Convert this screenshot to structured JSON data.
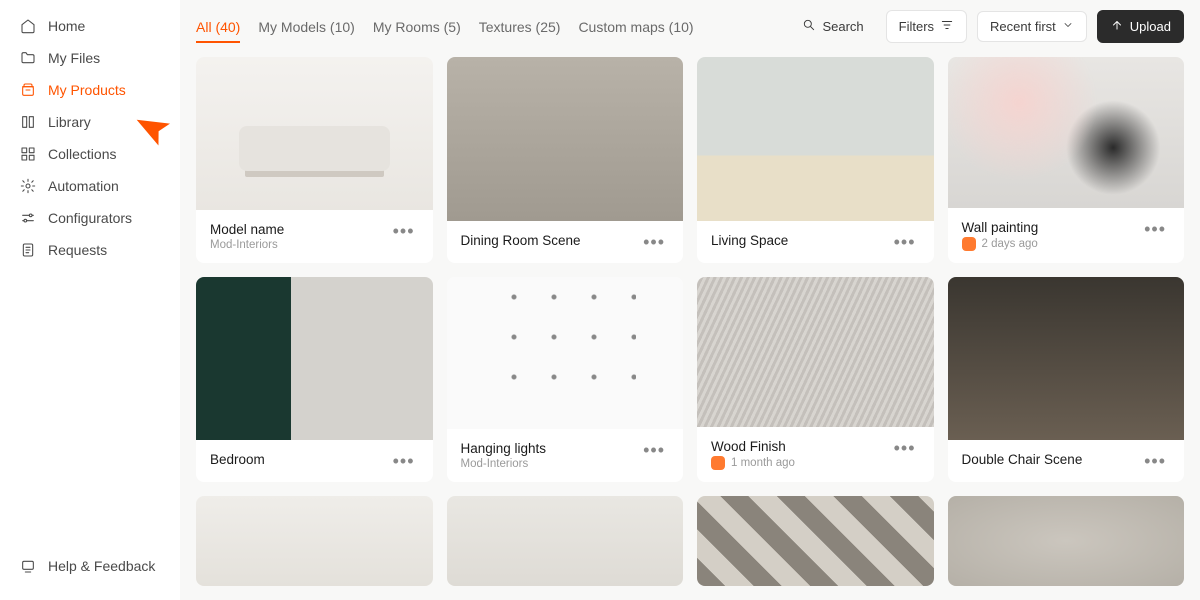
{
  "sidebar": {
    "items": [
      {
        "label": "Home",
        "icon": "home-icon"
      },
      {
        "label": "My Files",
        "icon": "folder-icon"
      },
      {
        "label": "My Products",
        "icon": "products-icon",
        "active": true
      },
      {
        "label": "Library",
        "icon": "library-icon"
      },
      {
        "label": "Collections",
        "icon": "collections-icon"
      },
      {
        "label": "Automation",
        "icon": "automation-icon"
      },
      {
        "label": "Configurators",
        "icon": "configurators-icon"
      },
      {
        "label": "Requests",
        "icon": "requests-icon"
      }
    ],
    "footer": [
      {
        "label": "Help & Feedback",
        "icon": "help-icon"
      }
    ]
  },
  "tabs": [
    {
      "label": "All (40)",
      "active": true
    },
    {
      "label": "My Models (10)"
    },
    {
      "label": "My Rooms (5)"
    },
    {
      "label": "Textures (25)"
    },
    {
      "label": "Custom maps (10)"
    }
  ],
  "controls": {
    "search": "Search",
    "filters": "Filters",
    "sort": "Recent first",
    "upload": "Upload"
  },
  "cards": [
    {
      "title": "Model name",
      "sub": "Mod-Interiors"
    },
    {
      "title": "Dining Room Scene",
      "sub": ""
    },
    {
      "title": "Living Space",
      "sub": ""
    },
    {
      "title": "Wall painting",
      "sub": "2 days ago",
      "badge": true
    },
    {
      "title": "Bedroom",
      "sub": ""
    },
    {
      "title": "Hanging lights",
      "sub": "Mod-Interiors"
    },
    {
      "title": "Wood Finish",
      "sub": "1 month ago",
      "badge": true
    },
    {
      "title": "Double Chair Scene",
      "sub": ""
    }
  ]
}
